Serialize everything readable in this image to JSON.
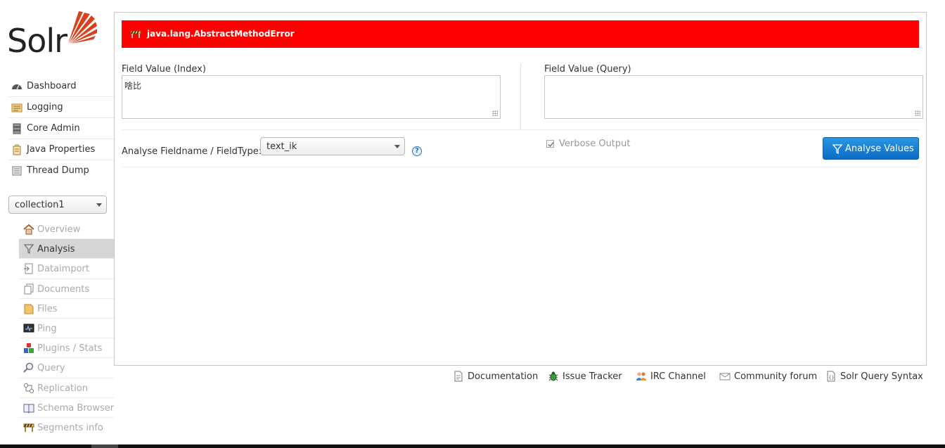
{
  "logo": {
    "wordmark": "Solr",
    "accent": "#d9411e"
  },
  "main_nav": [
    {
      "label": "Dashboard",
      "icon": "dashboard-icon"
    },
    {
      "label": "Logging",
      "icon": "logging-icon"
    },
    {
      "label": "Core Admin",
      "icon": "core-admin-icon"
    },
    {
      "label": "Java Properties",
      "icon": "java-properties-icon"
    },
    {
      "label": "Thread Dump",
      "icon": "thread-dump-icon"
    }
  ],
  "core_selector": {
    "value": "collection1"
  },
  "core_nav": [
    {
      "label": "Overview",
      "icon": "home-icon",
      "active": false
    },
    {
      "label": "Analysis",
      "icon": "funnel-icon",
      "active": true
    },
    {
      "label": "Dataimport",
      "icon": "dataimport-icon",
      "active": false
    },
    {
      "label": "Documents",
      "icon": "documents-icon",
      "active": false
    },
    {
      "label": "Files",
      "icon": "folder-icon",
      "active": false
    },
    {
      "label": "Ping",
      "icon": "ping-icon",
      "active": false
    },
    {
      "label": "Plugins / Stats",
      "icon": "plugins-icon",
      "active": false
    },
    {
      "label": "Query",
      "icon": "magnifier-icon",
      "active": false
    },
    {
      "label": "Replication",
      "icon": "replication-icon",
      "active": false
    },
    {
      "label": "Schema Browser",
      "icon": "book-icon",
      "active": false
    },
    {
      "label": "Segments info",
      "icon": "segments-icon",
      "active": false
    }
  ],
  "analysis": {
    "error": {
      "message": "java.lang.AbstractMethodError",
      "color": "#ff0000"
    },
    "index_label": "Field Value (Index)",
    "index_value": "啥比",
    "query_label": "Field Value (Query)",
    "query_value": "",
    "fieldtype_label": "Analyse Fieldname / FieldType:",
    "fieldtype_value": "text_ik",
    "help_glyph": "?",
    "verbose_label": "Verbose Output",
    "verbose_checked": true,
    "analyse_button": "Analyse Values",
    "button_color": "#1a7fd6"
  },
  "footer": [
    {
      "label": "Documentation",
      "icon": "document-icon"
    },
    {
      "label": "Issue Tracker",
      "icon": "bug-icon"
    },
    {
      "label": "IRC Channel",
      "icon": "users-icon"
    },
    {
      "label": "Community forum",
      "icon": "mail-icon"
    },
    {
      "label": "Solr Query Syntax",
      "icon": "query-syntax-icon"
    }
  ]
}
